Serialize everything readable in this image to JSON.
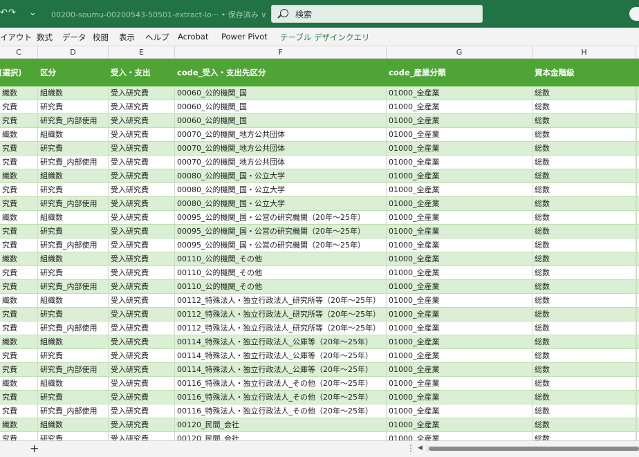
{
  "titlebar": {
    "filename": "00200-soumu-00200543-50501-extract-lo···  • 保存済み ∨",
    "search_placeholder": "検索",
    "undo_icon": "↶",
    "redo_icon": "↷",
    "qat_icon": "⌄"
  },
  "ribbon": {
    "tabs": [
      {
        "label": "イアウト"
      },
      {
        "label": "数式"
      },
      {
        "label": "データ"
      },
      {
        "label": "校閲"
      },
      {
        "label": "表示"
      },
      {
        "label": "ヘルプ"
      },
      {
        "label": "Acrobat"
      },
      {
        "label": "Power Pivot"
      },
      {
        "label": "テーブル デザイン"
      },
      {
        "label": "クエリ"
      }
    ]
  },
  "columns": {
    "letters": [
      "C",
      "D",
      "E",
      "F",
      "G",
      "H"
    ]
  },
  "table": {
    "headers": [
      "(選択)",
      "区分",
      "受入・支出",
      "code_受入・支出先区分",
      "code_産業分類",
      "資本金階級"
    ],
    "rows": [
      [
        "織数",
        "組織数",
        "受入研究費",
        "00060_公的機関_国",
        "01000_全産業",
        "総数"
      ],
      [
        "究費",
        "研究費",
        "受入研究費",
        "00060_公的機関_国",
        "01000_全産業",
        "総数"
      ],
      [
        "究費",
        "研究費_内部使用",
        "受入研究費",
        "00060_公的機関_国",
        "01000_全産業",
        "総数"
      ],
      [
        "織数",
        "組織数",
        "受入研究費",
        "00070_公的機関_地方公共団体",
        "01000_全産業",
        "総数"
      ],
      [
        "究費",
        "研究費",
        "受入研究費",
        "00070_公的機関_地方公共団体",
        "01000_全産業",
        "総数"
      ],
      [
        "究費",
        "研究費_内部使用",
        "受入研究費",
        "00070_公的機関_地方公共団体",
        "01000_全産業",
        "総数"
      ],
      [
        "織数",
        "組織数",
        "受入研究費",
        "00080_公的機関_国・公立大学",
        "01000_全産業",
        "総数"
      ],
      [
        "究費",
        "研究費",
        "受入研究費",
        "00080_公的機関_国・公立大学",
        "01000_全産業",
        "総数"
      ],
      [
        "究費",
        "研究費_内部使用",
        "受入研究費",
        "00080_公的機関_国・公立大学",
        "01000_全産業",
        "総数"
      ],
      [
        "織数",
        "組織数",
        "受入研究費",
        "00095_公的機関_国・公営の研究機関（20年～25年）",
        "01000_全産業",
        "総数"
      ],
      [
        "究費",
        "研究費",
        "受入研究費",
        "00095_公的機関_国・公営の研究機関（20年～25年）",
        "01000_全産業",
        "総数"
      ],
      [
        "究費",
        "研究費_内部使用",
        "受入研究費",
        "00095_公的機関_国・公営の研究機関（20年～25年）",
        "01000_全産業",
        "総数"
      ],
      [
        "織数",
        "組織数",
        "受入研究費",
        "00110_公的機関_その他",
        "01000_全産業",
        "総数"
      ],
      [
        "究費",
        "研究費",
        "受入研究費",
        "00110_公的機関_その他",
        "01000_全産業",
        "総数"
      ],
      [
        "究費",
        "研究費_内部使用",
        "受入研究費",
        "00110_公的機関_その他",
        "01000_全産業",
        "総数"
      ],
      [
        "織数",
        "組織数",
        "受入研究費",
        "00112_特殊法人・独立行政法人_研究所等（20年～25年）",
        "01000_全産業",
        "総数"
      ],
      [
        "究費",
        "研究費",
        "受入研究費",
        "00112_特殊法人・独立行政法人_研究所等（20年～25年）",
        "01000_全産業",
        "総数"
      ],
      [
        "究費",
        "研究費_内部使用",
        "受入研究費",
        "00112_特殊法人・独立行政法人_研究所等（20年～25年）",
        "01000_全産業",
        "総数"
      ],
      [
        "織数",
        "組織数",
        "受入研究費",
        "00114_特殊法人・独立行政法人_公庫等（20年～25年）",
        "01000_全産業",
        "総数"
      ],
      [
        "究費",
        "研究費",
        "受入研究費",
        "00114_特殊法人・独立行政法人_公庫等（20年～25年）",
        "01000_全産業",
        "総数"
      ],
      [
        "究費",
        "研究費_内部使用",
        "受入研究費",
        "00114_特殊法人・独立行政法人_公庫等（20年～25年）",
        "01000_全産業",
        "総数"
      ],
      [
        "織数",
        "組織数",
        "受入研究費",
        "00116_特殊法人・独立行政法人_その他（20年～25年）",
        "01000_全産業",
        "総数"
      ],
      [
        "究費",
        "研究費",
        "受入研究費",
        "00116_特殊法人・独立行政法人_その他（20年～25年）",
        "01000_全産業",
        "総数"
      ],
      [
        "究費",
        "研究費_内部使用",
        "受入研究費",
        "00116_特殊法人・独立行政法人_その他（20年～25年）",
        "01000_全産業",
        "総数"
      ],
      [
        "織数",
        "組織数",
        "受入研究費",
        "00120_民間_会社",
        "01000_全産業",
        "総数"
      ],
      [
        "究費",
        "研究費",
        "受入研究費",
        "00120_民間_会社",
        "01000_全産業",
        "総数"
      ]
    ]
  },
  "bottombar": {
    "add_sheet": "+",
    "dots": "⋮",
    "scroll_left": "◀"
  }
}
